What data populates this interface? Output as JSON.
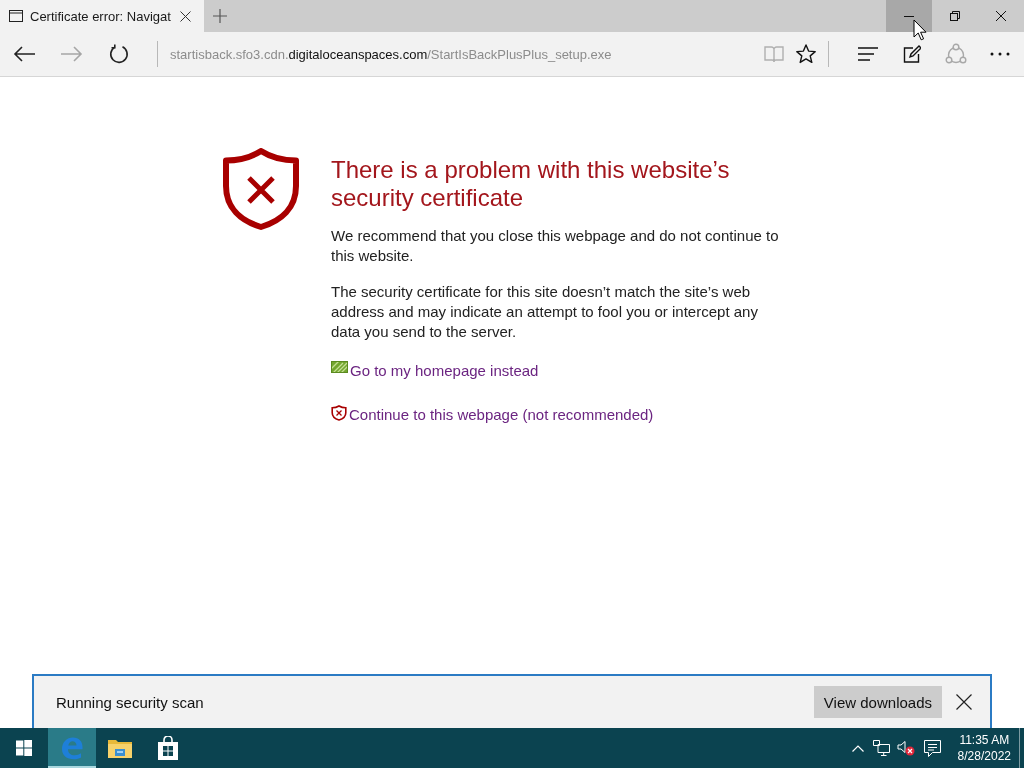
{
  "tabs": [
    {
      "title": "Certificate error: Navigat",
      "selected": true
    }
  ],
  "window_controls": [
    {
      "kind": "minimize",
      "hovered": true
    },
    {
      "kind": "restore",
      "hovered": false
    },
    {
      "kind": "close",
      "hovered": false
    }
  ],
  "nav_buttons": [
    {
      "kind": "back",
      "disabled": false
    },
    {
      "kind": "forward",
      "disabled": true
    },
    {
      "kind": "refresh",
      "disabled": false
    }
  ],
  "address_bar": {
    "prefix": "startisback.sfo3.cdn.",
    "domain": "digitaloceanspaces.com",
    "path": "/StartIsBackPlusPlus_setup.exe"
  },
  "page_actions": [
    {
      "kind": "reading-view",
      "disabled": true
    },
    {
      "kind": "favorite",
      "disabled": false
    }
  ],
  "toolbar_buttons": [
    {
      "kind": "hub",
      "disabled": false
    },
    {
      "kind": "note",
      "disabled": false
    },
    {
      "kind": "share",
      "disabled": true
    },
    {
      "kind": "more",
      "disabled": false
    }
  ],
  "error_page": {
    "title": "There is a problem with this website’s security certificate",
    "paragraphs": [
      "We recommend that you close this webpage and do not continue to this website.",
      "The security certificate for this site doesn’t match the site’s web address and may indicate an attempt to fool you or intercept any data you send to the server."
    ],
    "links": [
      {
        "kind": "home",
        "label": "Go to my homepage instead"
      },
      {
        "kind": "continue",
        "label": "Continue to this webpage (not recommended)"
      }
    ]
  },
  "download_bar": {
    "message": "Running security scan",
    "button": "View downloads"
  },
  "taskbar": {
    "apps": [
      {
        "kind": "edge",
        "active": true
      },
      {
        "kind": "file-explorer",
        "active": false
      },
      {
        "kind": "store",
        "active": false
      }
    ],
    "tray": {
      "volume_muted": true,
      "time": "11:35 AM",
      "date": "8/28/2022"
    }
  }
}
